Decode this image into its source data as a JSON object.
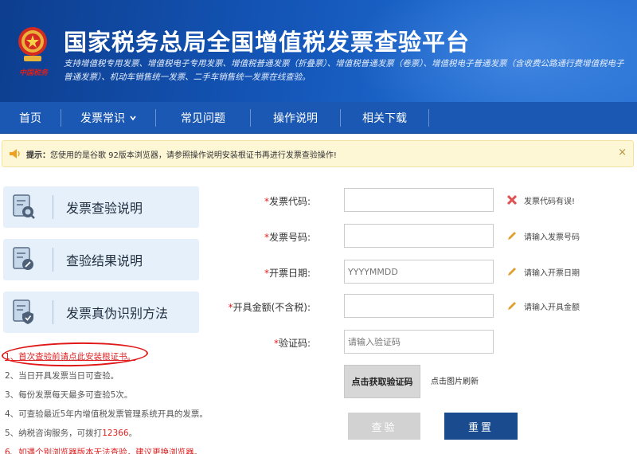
{
  "header": {
    "emblem_caption": "中国税务",
    "title": "国家税务总局全国增值税发票查验平台",
    "description": "支持增值税专用发票、增值税电子专用发票、增值税普通发票（折叠票）、增值税普通发票（卷票）、增值税电子普通发票（含收费公路通行费增值税电子普通发票）、机动车销售统一发票、二手车销售统一发票在线查验。"
  },
  "nav": {
    "items": [
      {
        "label": "首页"
      },
      {
        "label": "发票常识"
      },
      {
        "label": "常见问题"
      },
      {
        "label": "操作说明"
      },
      {
        "label": "相关下载"
      }
    ]
  },
  "notice": {
    "prefix": "提示：",
    "text": "您使用的是谷歌 92版本浏览器，请参照操作说明安装根证书再进行发票查验操作!",
    "close": "×"
  },
  "side": {
    "items": [
      {
        "label": "发票查验说明",
        "icon": "doc-search-icon"
      },
      {
        "label": "查验结果说明",
        "icon": "doc-edit-icon"
      },
      {
        "label": "发票真伪识别方法",
        "icon": "doc-shield-icon"
      }
    ]
  },
  "tips": {
    "t1": "1、首次查验前请点此安装根证书。",
    "t2": "2、当日开具发票当日可查验。",
    "t3": "3、每份发票每天最多可查验5次。",
    "t4": "4、可查验最近5年内增值税发票管理系统开具的发票。",
    "t5_prefix": "5、纳税咨询服务，可拨打",
    "t5_phone": "12366",
    "t5_suffix": "。",
    "t6": "6、如遇个别浏览器版本无法查验，建议更换浏览器。"
  },
  "form": {
    "code": {
      "req": "*",
      "label": "发票代码:",
      "value": "",
      "placeholder": "",
      "hint": "发票代码有误!"
    },
    "number": {
      "req": "*",
      "label": "发票号码:",
      "value": "",
      "placeholder": "",
      "hint": "请输入发票号码"
    },
    "date": {
      "req": "*",
      "label": "开票日期:",
      "value": "",
      "placeholder": "YYYYMMDD",
      "hint": "请输入开票日期"
    },
    "amount": {
      "req": "*",
      "label": "开具金额(不含税):",
      "value": "",
      "placeholder": "",
      "hint": "请输入开具金额"
    },
    "captcha": {
      "req": "*",
      "label": "验证码:",
      "value": "",
      "placeholder": "请输入验证码"
    },
    "captcha_image_text": "点击获取验证码",
    "captcha_refresh": "点击图片刷新",
    "check_button": "查验",
    "reset_button": "重置"
  },
  "colors": {
    "banner": "#1456b8",
    "nav": "#1b58b3",
    "error": "#e02020",
    "reset_button": "#1a4b8e",
    "disabled_button": "#d2d2d2",
    "notice_bg": "#fdf7d6"
  }
}
